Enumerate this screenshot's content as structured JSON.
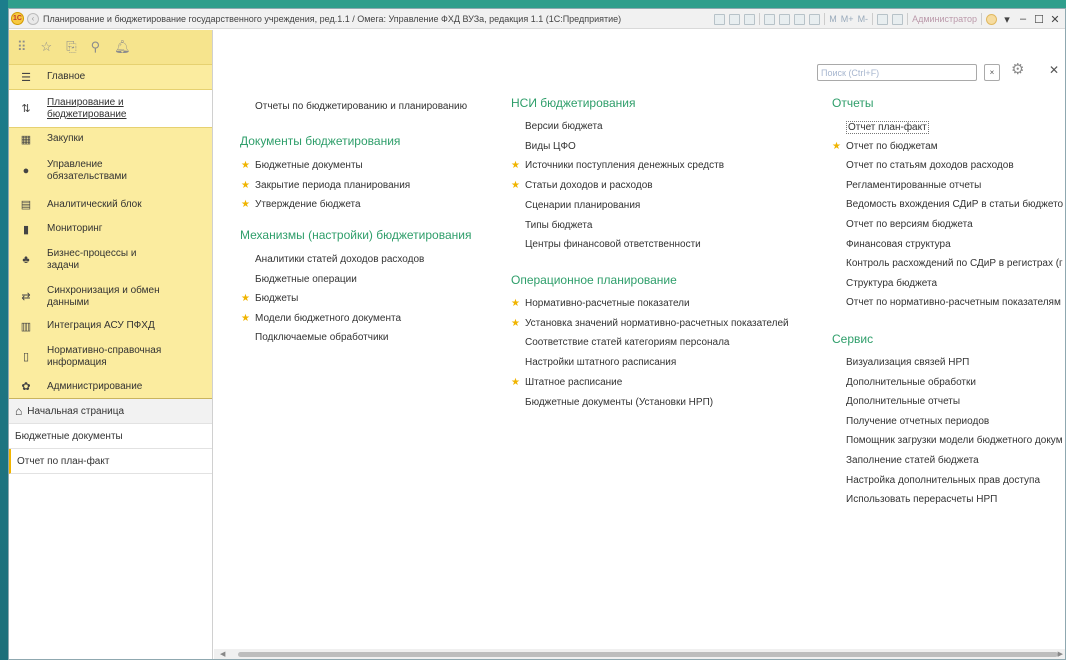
{
  "window": {
    "title": "Планирование и бюджетирование государственного учреждения, ред.1.1 / Омега: Управление ФХД ВУЗа, редакция 1.1  (1С:Предприятие)",
    "toolbar": {
      "m": "M",
      "mplus": "M+",
      "mminus": "M-",
      "user": "Администратор",
      "minimize": "–",
      "restore": "☐",
      "close": "✕"
    }
  },
  "sidebar": {
    "sections": [
      {
        "label": "Главное",
        "icon": "menu-icon"
      },
      {
        "label": "Планирование и бюджетирование",
        "icon": "planning-icon",
        "active": true
      },
      {
        "label": "Закупки",
        "icon": "purchases-icon"
      },
      {
        "label": "Управление обязательствами",
        "icon": "obligations-icon"
      },
      {
        "label": "Аналитический блок",
        "icon": "analytics-icon"
      },
      {
        "label": "Мониторинг",
        "icon": "monitoring-icon"
      },
      {
        "label": "Бизнес-процессы и задачи",
        "icon": "business-process-icon"
      },
      {
        "label": "Синхронизация и обмен данными",
        "icon": "sync-icon"
      },
      {
        "label": "Интеграция АСУ ПФХД",
        "icon": "integration-icon"
      },
      {
        "label": "Нормативно-справочная информация",
        "icon": "reference-icon"
      },
      {
        "label": "Администрирование",
        "icon": "gear-icon"
      }
    ],
    "open_pages": [
      {
        "label": "Начальная страница"
      },
      {
        "label": "Бюджетные документы"
      },
      {
        "label": "Отчет по план-факт"
      }
    ]
  },
  "main": {
    "search_placeholder": "Поиск (Ctrl+F)",
    "col1": {
      "top_link": "Отчеты по бюджетированию и планированию",
      "groups": [
        {
          "title": "Документы бюджетирования",
          "items": [
            {
              "label": "Бюджетные документы",
              "star": true
            },
            {
              "label": "Закрытие периода планирования",
              "star": true
            },
            {
              "label": "Утверждение бюджета",
              "star": true
            }
          ]
        },
        {
          "title": "Механизмы (настройки) бюджетирования",
          "items": [
            {
              "label": "Аналитики статей доходов расходов",
              "star": false
            },
            {
              "label": "Бюджетные операции",
              "star": false
            },
            {
              "label": "Бюджеты",
              "star": true
            },
            {
              "label": "Модели бюджетного документа",
              "star": true
            },
            {
              "label": "Подключаемые обработчики",
              "star": false
            }
          ]
        }
      ]
    },
    "col2": {
      "groups": [
        {
          "title": "НСИ бюджетирования",
          "items": [
            {
              "label": "Версии бюджета",
              "star": false
            },
            {
              "label": "Виды ЦФО",
              "star": false
            },
            {
              "label": "Источники поступления денежных средств",
              "star": true
            },
            {
              "label": "Статьи доходов и расходов",
              "star": true
            },
            {
              "label": "Сценарии планирования",
              "star": false
            },
            {
              "label": "Типы бюджета",
              "star": false
            },
            {
              "label": "Центры финансовой ответственности",
              "star": false
            }
          ]
        },
        {
          "title": "Операционное планирование",
          "items": [
            {
              "label": "Нормативно-расчетные показатели",
              "star": true
            },
            {
              "label": "Установка значений нормативно-расчетных показателей",
              "star": true
            },
            {
              "label": "Соответствие статей категориям персонала",
              "star": false
            },
            {
              "label": "Настройки штатного расписания",
              "star": false
            },
            {
              "label": "Штатное расписание",
              "star": true
            },
            {
              "label": "Бюджетные документы (Установки НРП)",
              "star": false
            }
          ]
        }
      ]
    },
    "col3": {
      "groups": [
        {
          "title": "Отчеты",
          "items": [
            {
              "label": "Отчет план-факт",
              "star": false,
              "focused": true
            },
            {
              "label": "Отчет по бюджетам",
              "star": true
            },
            {
              "label": "Отчет по статьям доходов расходов",
              "star": false
            },
            {
              "label": "Регламентированные отчеты",
              "star": false
            },
            {
              "label": "Ведомость вхождения СДиР в статьи бюджето",
              "star": false
            },
            {
              "label": "Отчет по версиям бюджета",
              "star": false
            },
            {
              "label": "Финансовая структура",
              "star": false
            },
            {
              "label": "Контроль расхождений по СДиР в регистрах (г",
              "star": false
            },
            {
              "label": "Структура бюджета",
              "star": false
            },
            {
              "label": "Отчет по нормативно-расчетным показателям",
              "star": false
            }
          ]
        },
        {
          "title": "Сервис",
          "items": [
            {
              "label": "Визуализация связей НРП",
              "star": false
            },
            {
              "label": "Дополнительные обработки",
              "star": false
            },
            {
              "label": "Дополнительные отчеты",
              "star": false
            },
            {
              "label": "Получение отчетных периодов",
              "star": false
            },
            {
              "label": "Помощник загрузки модели бюджетного докум",
              "star": false
            },
            {
              "label": "Заполнение статей бюджета",
              "star": false
            },
            {
              "label": "Настройка дополнительных прав доступа",
              "star": false
            },
            {
              "label": "Использовать перерасчеты НРП",
              "star": false
            }
          ]
        }
      ]
    }
  }
}
